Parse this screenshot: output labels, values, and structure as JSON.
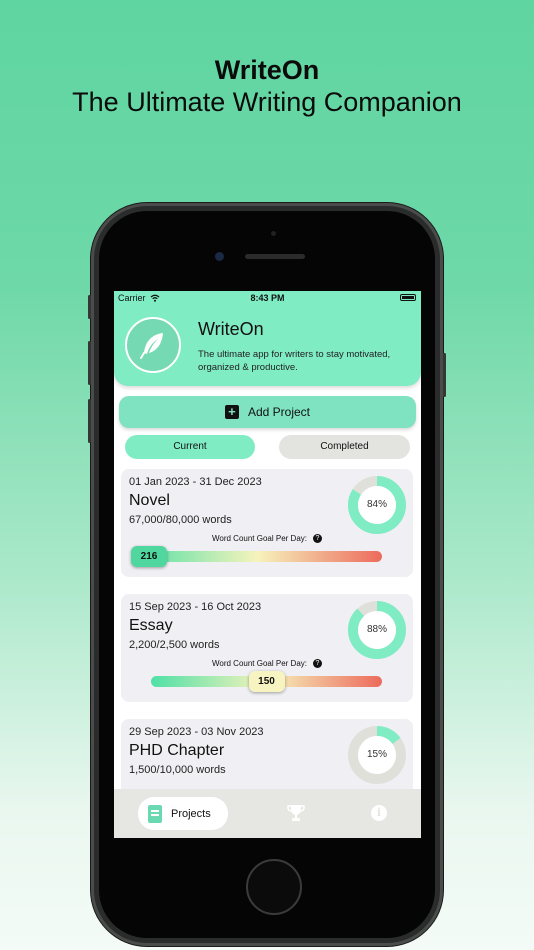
{
  "promo": {
    "title": "WriteOn",
    "subtitle": "The Ultimate Writing Companion"
  },
  "status_bar": {
    "carrier": "Carrier",
    "time": "8:43 PM"
  },
  "header": {
    "app_name": "WriteOn",
    "description": "The ultimate app for writers to stay motivated, organized & productive."
  },
  "add_project": {
    "label": "Add Project"
  },
  "tabs": {
    "current": "Current",
    "completed": "Completed"
  },
  "projects": [
    {
      "dates": "01 Jan 2023 - 31 Dec 2023",
      "title": "Novel",
      "words": "67,000/80,000 words",
      "progress_label": "84%",
      "progress": 0.84,
      "goal_label": "Word Count Goal Per Day:",
      "goal_value": "216",
      "slider_fraction": 0.02
    },
    {
      "dates": "15 Sep 2023 - 16 Oct 2023",
      "title": "Essay",
      "words": "2,200/2,500 words",
      "progress_label": "88%",
      "progress": 0.88,
      "goal_label": "Word Count Goal Per Day:",
      "goal_value": "150",
      "slider_fraction": 0.5
    },
    {
      "dates": "29 Sep 2023 - 03 Nov 2023",
      "title": "PHD Chapter",
      "words": "1,500/10,000 words",
      "progress_label": "15%",
      "progress": 0.15
    }
  ],
  "nav": {
    "projects": "Projects"
  },
  "icons": {
    "logo": "feather-icon",
    "add": "plus-square-icon",
    "help": "question-circle-icon",
    "projects": "book-icon",
    "achievements": "trophy-icon",
    "info": "info-icon"
  },
  "colors": {
    "mint": "#7fecc4",
    "donut_fill": "#7fecc4",
    "donut_track": "#e0e0db",
    "thumb_green": "#4fd79f",
    "thumb_yellow": "#f7f4c1"
  }
}
